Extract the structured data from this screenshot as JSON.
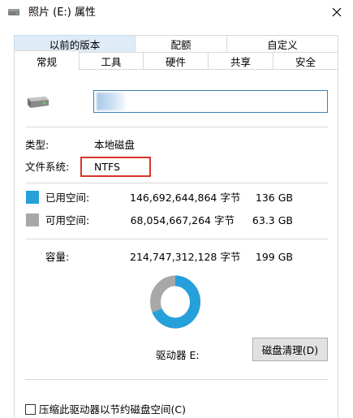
{
  "window": {
    "title": "照片 (E:) 属性"
  },
  "tabs_row1": [
    "以前的版本",
    "配额",
    "自定义"
  ],
  "tabs_row2": [
    "常规",
    "工具",
    "硬件",
    "共享",
    "安全"
  ],
  "general": {
    "name_value": "",
    "type_label": "类型:",
    "type_value": "本地磁盘",
    "fs_label": "文件系统:",
    "fs_value": "NTFS",
    "used": {
      "label": "已用空间:",
      "bytes": "146,692,644,864 字节",
      "size": "136 GB",
      "color": "#26a0da"
    },
    "free": {
      "label": "可用空间:",
      "bytes": "68,054,667,264 字节",
      "size": "63.3 GB",
      "color": "#a8a8a8"
    },
    "capacity": {
      "label": "容量:",
      "bytes": "214,747,312,128 字节",
      "size": "199 GB"
    },
    "used_fraction": 0.683,
    "drive_label": "驱动器 E:",
    "cleanup_button": "磁盘清理(D)",
    "compress_label": "压缩此驱动器以节约磁盘空间(C)",
    "compress_checked": false
  },
  "icons": {
    "title": "drive-icon",
    "close": "close-icon",
    "drive": "drive-icon"
  }
}
